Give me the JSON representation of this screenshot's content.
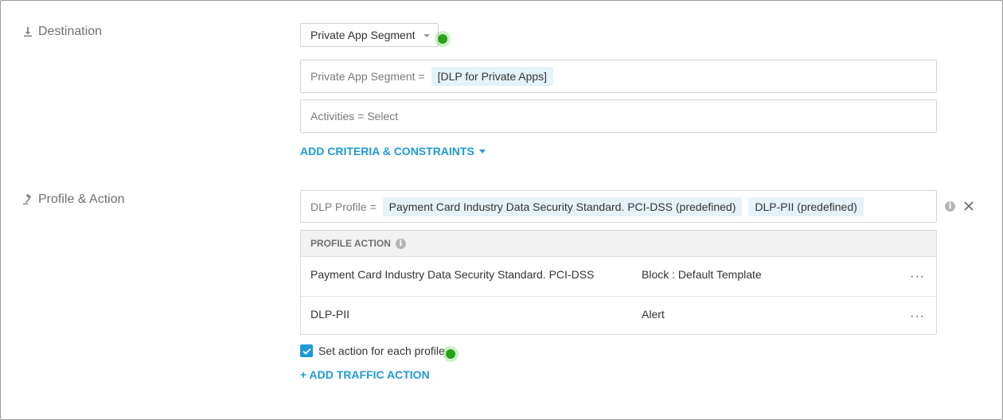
{
  "destination": {
    "label": "Destination",
    "icon": "download-icon",
    "segment_dropdown": {
      "value": "Private App Segment"
    },
    "private_app_field": {
      "label": "Private App Segment =",
      "chips": [
        "[DLP for Private Apps]"
      ]
    },
    "activities_field": {
      "label": "Activities = Select"
    },
    "add_criteria": {
      "label": "ADD CRITERIA & CONSTRAINTS",
      "icon": "caret-down-icon"
    }
  },
  "profile_action": {
    "label": "Profile & Action",
    "icon": "gavel-icon",
    "dlp_field": {
      "label": "DLP Profile =",
      "chips": [
        "Payment Card Industry Data Security Standard. PCI-DSS (predefined)",
        "DLP-PII (predefined)"
      ]
    },
    "table": {
      "header": "PROFILE ACTION",
      "rows": [
        {
          "profile": "Payment Card Industry Data Security Standard. PCI-DSS",
          "action": "Block : Default Template",
          "more": "···"
        },
        {
          "profile": "DLP-PII",
          "action": "Alert",
          "more": "···"
        }
      ]
    },
    "set_action_checkbox": {
      "label": "Set action for each profile",
      "checked": true
    },
    "add_traffic_action": {
      "label": "+ ADD TRAFFIC ACTION"
    }
  },
  "colors": {
    "accent": "#1f9ad6",
    "chip_bg": "#e6f2fa",
    "hint_dot": "#2aa11a"
  }
}
